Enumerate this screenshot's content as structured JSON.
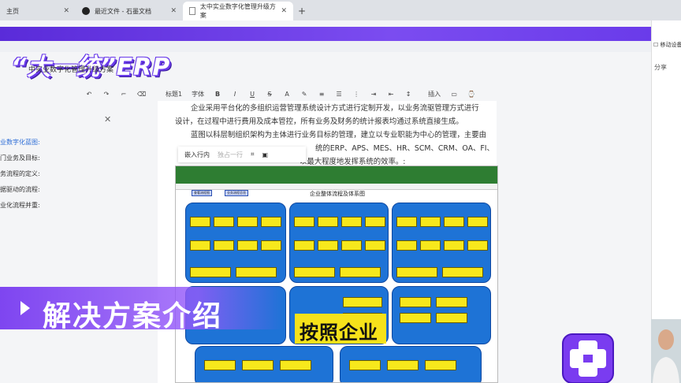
{
  "browser": {
    "tabs": [
      {
        "label": "主页"
      },
      {
        "label": "最近文件 - 石墨文档"
      },
      {
        "label": "太中实业数字化管理升级方案"
      }
    ],
    "new_tab": "+"
  },
  "logo": {
    "text": "“大一统”ERP",
    "doc_title": "中实业数字化管理升级方案"
  },
  "right_panel": {
    "share": "分享",
    "device": "移动设备"
  },
  "toolbar": {
    "heading": "标题1",
    "font": "字体",
    "insert": "插入"
  },
  "sidebar": {
    "items": [
      "业数字化蓝图:",
      "门业务及目标:",
      "务流程的定义:",
      "据驱动的流程:",
      "业化流程并重:"
    ]
  },
  "document": {
    "lines": [
      "企业采用平台化的多组织运营管理系统设计方式进行定制开发，以业务流驱管理方式进行",
      "设计，在过程中进行费用及成本管控，所有业务及财务的统计报表均通过系统直接生成。",
      "蓝图以科层制组织架构为主体进行业务目标的管理，建立以专业职能为中心的管理，主要由",
      "统的ERP、APS、MES、HR、SCM、CRM、OA、FI、",
      "以最大程度地发挥系统的效率。:"
    ]
  },
  "image_toolbar": {
    "inline": "嵌入行内",
    "exclusive": "独占一行"
  },
  "embedded_sheet": {
    "title": "企业整体流程及体系图",
    "pill1": "查看流程图",
    "pill2": "业务流程总览"
  },
  "overlays": {
    "solution": "解决方案介绍",
    "subtitle": "按照企业"
  },
  "colors": {
    "brand_purple": "#6a3bea",
    "sheet_blue": "#1e73d6",
    "card_yellow": "#f7e81c",
    "subtitle_yellow": "#f6e21a"
  }
}
